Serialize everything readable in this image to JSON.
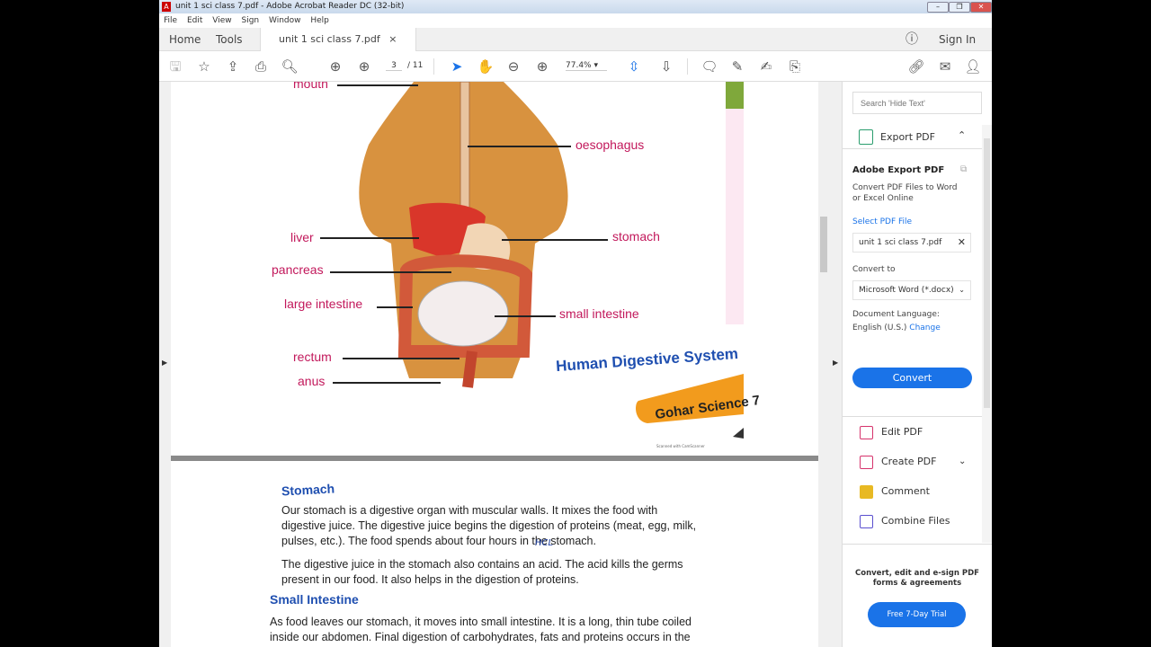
{
  "window": {
    "title": "unit 1 sci class 7.pdf - Adobe Acrobat Reader DC (32-bit)",
    "menu": [
      "File",
      "Edit",
      "View",
      "Sign",
      "Window",
      "Help"
    ]
  },
  "tabs": {
    "home": "Home",
    "tools": "Tools",
    "document": "unit 1 sci class 7.pdf",
    "close": "×",
    "sign_in": "Sign In"
  },
  "toolbar": {
    "page_current": "3",
    "page_total": "/ 11",
    "zoom": "77.4%"
  },
  "diagram": {
    "labels": {
      "mouth": "mouth",
      "oesophagus": "oesophagus",
      "liver": "liver",
      "stomach": "stomach",
      "pancreas": "pancreas",
      "large_intestine": "large intestine",
      "small_intestine": "small intestine",
      "rectum": "rectum",
      "anus": "anus"
    },
    "caption": "Human Digestive System",
    "badge": "Gohar Science 7",
    "scan_note": "Scanned with CamScanner"
  },
  "page2": {
    "h_stomach": "Stomach",
    "p1": "Our stomach is a digestive organ with muscular walls. It mixes the food with digestive juice. The digestive juice begins the digestion of proteins (meat, egg, milk, pulses, etc.). The food spends about four hours in the stomach.",
    "annotation": "HCL",
    "p2": "The digestive juice in the stomach also contains an acid. The acid kills the germs present in our food. It also helps in the digestion of proteins.",
    "h_small": "Small Intestine",
    "p3": "As food leaves our stomach, it moves into small intestine. It is a long, thin tube coiled inside our abdomen. Final digestion of carbohydrates, fats and proteins occurs in the"
  },
  "pane": {
    "search_placeholder": "Search 'Hide Text'",
    "export_header": "Export PDF",
    "adobe_export": "Adobe Export PDF",
    "desc": "Convert PDF Files to Word or Excel Online",
    "select_file": "Select PDF File",
    "file": "unit 1 sci class 7.pdf",
    "convert_to": "Convert to",
    "format": "Microsoft Word (*.docx)",
    "doc_lang": "Document Language:",
    "lang": "English (U.S.)",
    "change": "Change",
    "convert": "Convert",
    "tools": [
      "Edit PDF",
      "Create PDF",
      "Comment",
      "Combine Files"
    ],
    "promo": "Convert, edit and e-sign PDF forms & agreements",
    "trial": "Free 7-Day Trial"
  },
  "colors": {
    "accent": "#1a73e8",
    "label": "#c2185b",
    "heading": "#1f4fb0"
  }
}
